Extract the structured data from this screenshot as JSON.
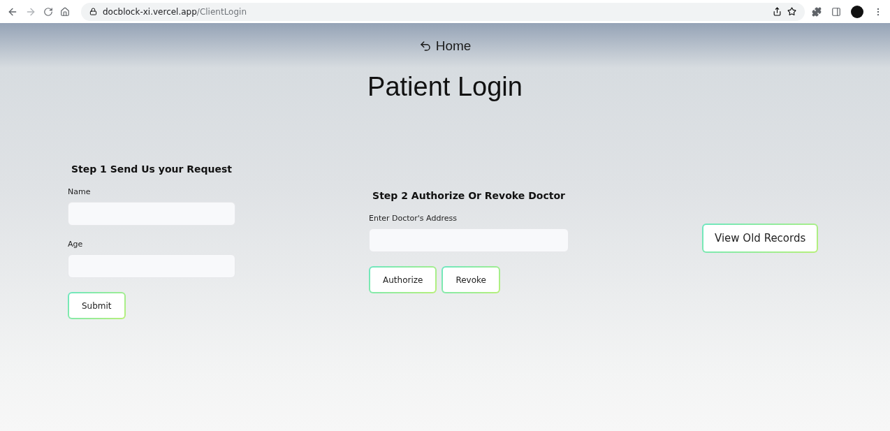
{
  "browser": {
    "url_host": "docblock-xi.vercel.app",
    "url_path": "/ClientLogin"
  },
  "nav": {
    "home_label": "Home"
  },
  "title": "Patient Login",
  "step1": {
    "heading": "Step 1 Send Us your Request",
    "fields": [
      {
        "label": "Name"
      },
      {
        "label": "Age"
      }
    ],
    "button": "Submit"
  },
  "step2": {
    "heading": "Step 2 Authorize Or Revoke Doctor",
    "fields": [
      {
        "label": "Enter Doctor's Address"
      }
    ],
    "buttons": [
      "Authorize",
      "Revoke"
    ]
  },
  "records_button": "View Old Records"
}
